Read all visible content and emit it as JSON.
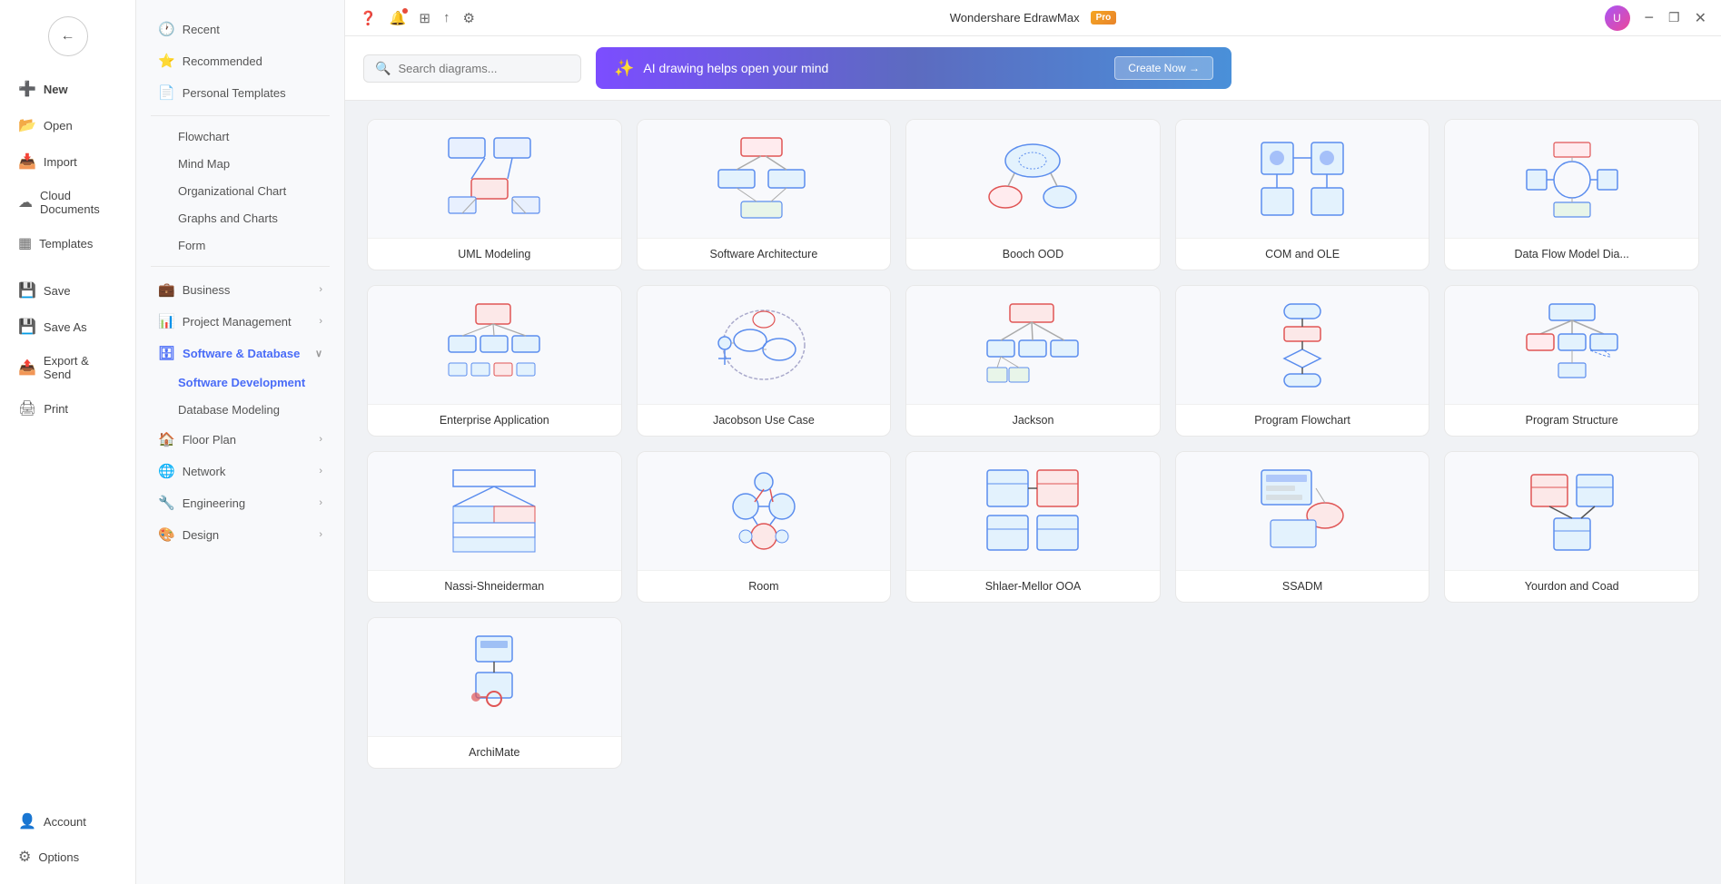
{
  "app": {
    "title": "Wondershare EdrawMax",
    "pro_badge": "Pro"
  },
  "window_controls": {
    "minimize": "−",
    "maximize": "❐",
    "close": "✕"
  },
  "sidebar_narrow": {
    "back_label": "←",
    "items": [
      {
        "id": "new",
        "label": "New",
        "icon": "➕",
        "active": true
      },
      {
        "id": "open",
        "label": "Open",
        "icon": "📂"
      },
      {
        "id": "import",
        "label": "Import",
        "icon": "📥"
      },
      {
        "id": "cloud",
        "label": "Cloud Documents",
        "icon": "☁"
      },
      {
        "id": "templates",
        "label": "Templates",
        "icon": "▦"
      },
      {
        "id": "save",
        "label": "Save",
        "icon": "💾"
      },
      {
        "id": "save-as",
        "label": "Save As",
        "icon": "💾"
      },
      {
        "id": "export",
        "label": "Export & Send",
        "icon": "📤"
      },
      {
        "id": "print",
        "label": "Print",
        "icon": "🖨"
      }
    ],
    "bottom_items": [
      {
        "id": "account",
        "label": "Account",
        "icon": "👤"
      },
      {
        "id": "options",
        "label": "Options",
        "icon": "⚙"
      }
    ]
  },
  "sidebar_wide": {
    "items": [
      {
        "id": "recent",
        "label": "Recent",
        "icon": "🕐",
        "has_chevron": false
      },
      {
        "id": "recommended",
        "label": "Recommended",
        "icon": "⭐",
        "has_chevron": false
      },
      {
        "id": "personal",
        "label": "Personal Templates",
        "icon": "📄",
        "has_chevron": false
      },
      {
        "id": "divider1"
      },
      {
        "id": "flowchart",
        "label": "Flowchart",
        "sub": true
      },
      {
        "id": "mindmap",
        "label": "Mind Map",
        "sub": true
      },
      {
        "id": "orgchart",
        "label": "Organizational Chart",
        "sub": true
      },
      {
        "id": "graphs",
        "label": "Graphs and Charts",
        "sub": true
      },
      {
        "id": "form",
        "label": "Form",
        "sub": true
      },
      {
        "id": "divider2"
      },
      {
        "id": "business",
        "label": "Business",
        "icon": "💼",
        "has_chevron": true
      },
      {
        "id": "project",
        "label": "Project Management",
        "icon": "📊",
        "has_chevron": true
      },
      {
        "id": "software",
        "label": "Software & Database",
        "icon": "🗄",
        "has_chevron": true,
        "active": true
      },
      {
        "id": "software-dev",
        "label": "Software Development",
        "sub": true,
        "active": true
      },
      {
        "id": "db-modeling",
        "label": "Database Modeling",
        "sub": true
      },
      {
        "id": "floorplan",
        "label": "Floor Plan",
        "icon": "🏠",
        "has_chevron": true
      },
      {
        "id": "network",
        "label": "Network",
        "icon": "🌐",
        "has_chevron": true
      },
      {
        "id": "engineering",
        "label": "Engineering",
        "icon": "🔧",
        "has_chevron": true
      },
      {
        "id": "design",
        "label": "Design",
        "icon": "🎨",
        "has_chevron": true
      }
    ]
  },
  "search": {
    "placeholder": "Search diagrams..."
  },
  "ai_banner": {
    "text": "AI drawing helps open your mind",
    "cta": "Create Now →"
  },
  "templates": [
    {
      "id": "uml",
      "label": "UML Modeling",
      "type": "uml"
    },
    {
      "id": "software-arch",
      "label": "Software Architecture",
      "type": "software-arch"
    },
    {
      "id": "booch-ood",
      "label": "Booch OOD",
      "type": "booch"
    },
    {
      "id": "com-ole",
      "label": "COM and OLE",
      "type": "com-ole"
    },
    {
      "id": "data-flow",
      "label": "Data Flow Model Dia...",
      "type": "data-flow"
    },
    {
      "id": "enterprise",
      "label": "Enterprise Application",
      "type": "enterprise"
    },
    {
      "id": "jacobson",
      "label": "Jacobson Use Case",
      "type": "jacobson"
    },
    {
      "id": "jackson",
      "label": "Jackson",
      "type": "jackson"
    },
    {
      "id": "program-flow",
      "label": "Program Flowchart",
      "type": "program-flow"
    },
    {
      "id": "program-struct",
      "label": "Program Structure",
      "type": "program-struct"
    },
    {
      "id": "nassi",
      "label": "Nassi-Shneiderman",
      "type": "nassi"
    },
    {
      "id": "room",
      "label": "Room",
      "type": "room"
    },
    {
      "id": "shlaer",
      "label": "Shlaer-Mellor OOA",
      "type": "shlaer"
    },
    {
      "id": "ssadm",
      "label": "SSADM",
      "type": "ssadm"
    },
    {
      "id": "yourdon",
      "label": "Yourdon and Coad",
      "type": "yourdon"
    },
    {
      "id": "archimate",
      "label": "ArchiMate",
      "type": "archimate"
    }
  ]
}
